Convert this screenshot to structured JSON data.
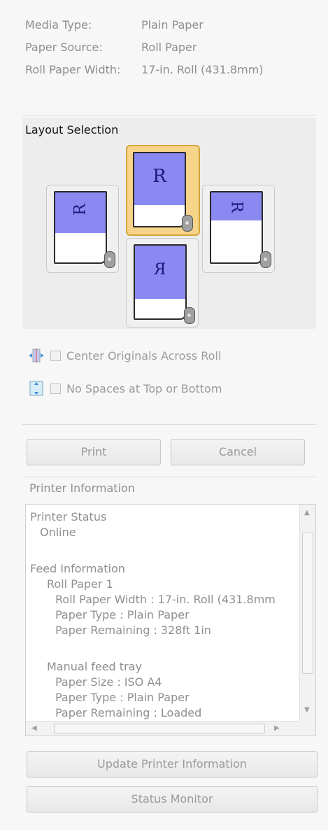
{
  "info": {
    "rows": [
      {
        "label": "Media Type:",
        "value": "Plain Paper"
      },
      {
        "label": "Paper Source:",
        "value": "Roll Paper"
      },
      {
        "label": "Roll Paper Width:",
        "value": "17-in. Roll (431.8mm)"
      }
    ]
  },
  "layout": {
    "title": "Layout Selection",
    "options": [
      {
        "letter": "R",
        "orientation": "rotated-left",
        "selected": false
      },
      {
        "letter": "R",
        "orientation": "upright",
        "selected": true
      },
      {
        "letter": "R",
        "orientation": "rotated-right",
        "selected": false
      },
      {
        "letter": "R",
        "orientation": "mirrored",
        "selected": false
      }
    ]
  },
  "options": {
    "center_originals": "Center Originals Across Roll",
    "no_spaces": "No Spaces at Top or Bottom"
  },
  "buttons": {
    "print": "Print",
    "cancel": "Cancel",
    "update": "Update Printer Information",
    "status_monitor": "Status Monitor"
  },
  "printer_info": {
    "heading": "Printer Information",
    "lines": [
      "Printer Status",
      "Online",
      "Feed Information",
      "Roll Paper 1",
      "Roll Paper Width : 17-in. Roll (431.8mm",
      "Paper Type : Plain Paper",
      "Paper Remaining : 328ft 1in",
      "Manual feed tray",
      "Paper Size : ISO A4",
      "Paper Type : Plain Paper",
      "Paper Remaining : Loaded"
    ]
  },
  "colors": {
    "paper_blue": "#8a89f2",
    "selected_border": "#d3a63a",
    "selected_fill": "#f7d48a"
  }
}
